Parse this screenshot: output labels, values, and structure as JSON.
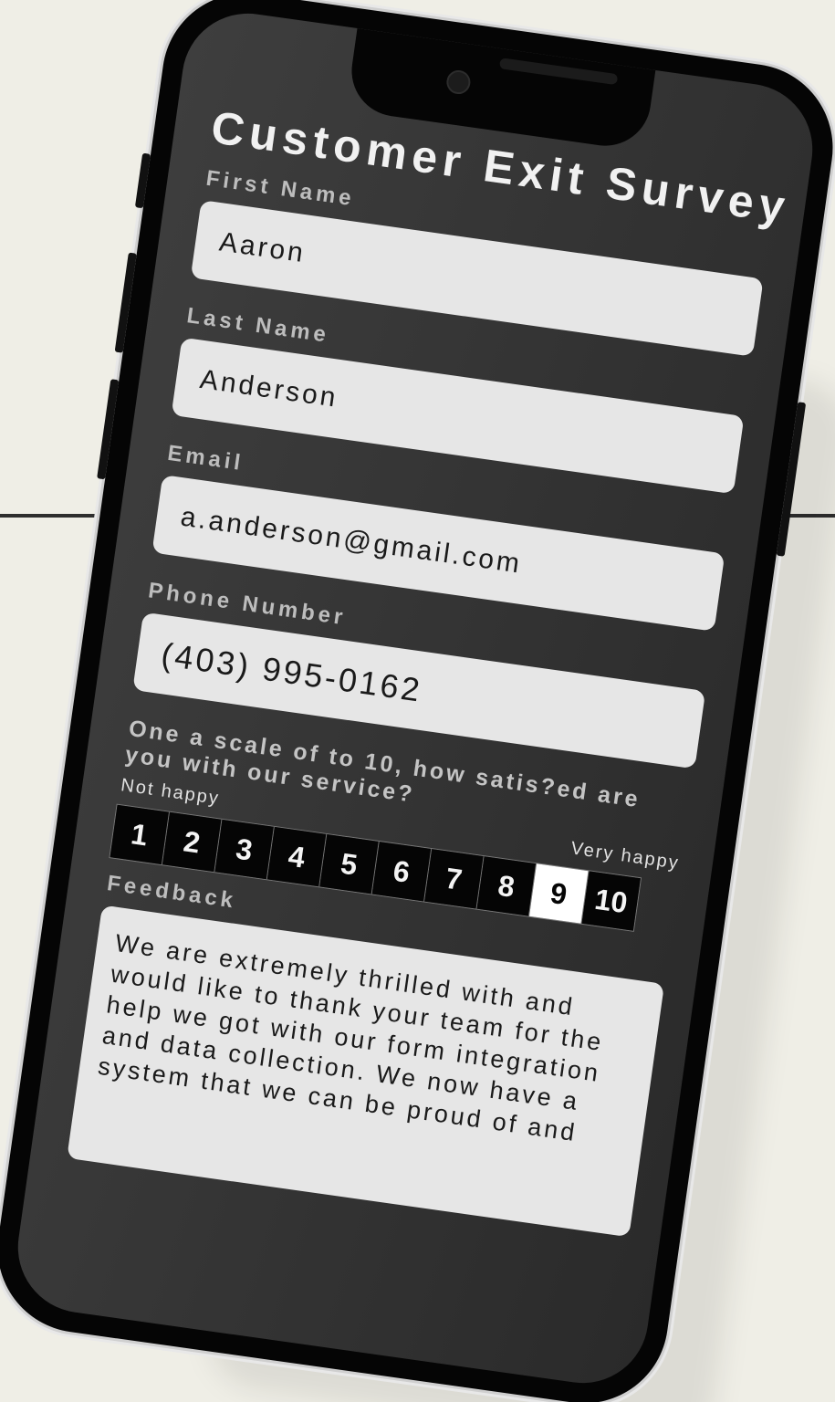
{
  "survey": {
    "title": "Customer Exit Survey",
    "fields": {
      "first_name": {
        "label": "First Name",
        "value": "Aaron"
      },
      "last_name": {
        "label": "Last Name",
        "value": "Anderson"
      },
      "email": {
        "label": "Email",
        "value": "a.anderson@gmail.com"
      },
      "phone": {
        "label": "Phone Number",
        "value": "(403) 995-0162"
      }
    },
    "rating": {
      "question": "One a scale of to 10, how satis?ed are you with our service?",
      "low_label": "Not happy",
      "high_label": "Very happy",
      "options": [
        "1",
        "2",
        "3",
        "4",
        "5",
        "6",
        "7",
        "8",
        "9",
        "10"
      ],
      "selected": "9"
    },
    "feedback": {
      "label": "Feedback",
      "value": "We are extremely thrilled with and would like to thank your team for the help we got with our form integration and data collection. We now have a system that we can be proud of and"
    }
  },
  "colors": {
    "background": "#efeee6",
    "screen": "#353535",
    "input": "#e6e6e6",
    "scale_cell": "#050505",
    "scale_selected": "#ffffff"
  }
}
